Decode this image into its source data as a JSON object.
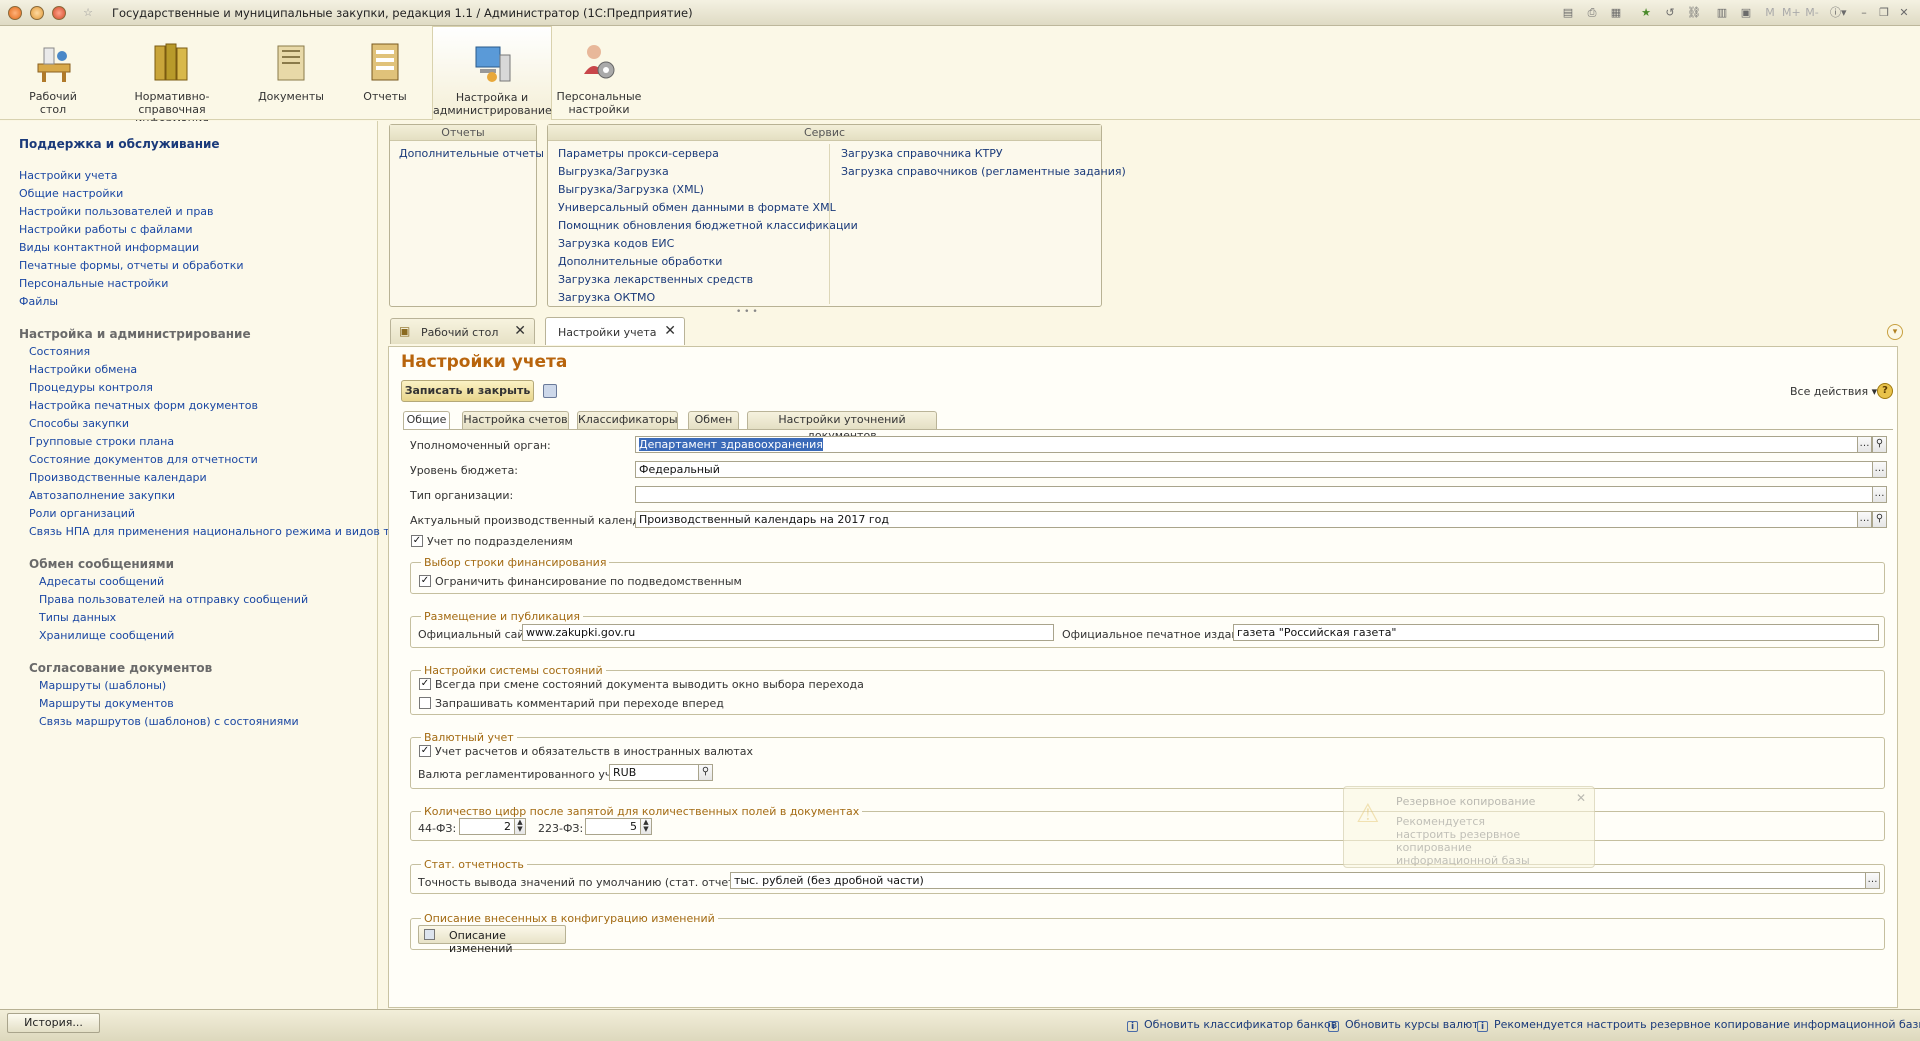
{
  "window": {
    "title": "Государственные и муниципальные закупки, редакция 1.1 / Администратор  (1С:Предприятие)",
    "right_icons": [
      "M",
      "M+",
      "M-"
    ]
  },
  "sections": [
    {
      "label": "Рабочий стол",
      "icon": "desk-icon"
    },
    {
      "label": "Нормативно-справочная информация",
      "icon": "books-icon"
    },
    {
      "label": "Документы",
      "icon": "documents-icon"
    },
    {
      "label": "Отчеты",
      "icon": "reports-icon"
    },
    {
      "label": "Настройка и администрирование",
      "icon": "computer-settings-icon"
    },
    {
      "label": "Персональные настройки",
      "icon": "person-settings-icon"
    }
  ],
  "nav": {
    "support_title": "Поддержка и обслуживание",
    "support_items": [
      "Настройки учета",
      "Общие настройки",
      "Настройки пользователей и прав",
      "Настройки работы с файлами",
      "Виды контактной информации",
      "Печатные формы, отчеты и обработки",
      "Персональные настройки",
      "Файлы"
    ],
    "admin_title": "Настройка и администрирование",
    "admin_items": [
      "Состояния",
      "Настройки обмена",
      "Процедуры контроля",
      "Настройка печатных форм документов",
      "Способы закупки",
      "Групповые строки плана",
      "Состояние документов для отчетности",
      "Производственные календари",
      "Автозаполнение закупки",
      "Роли организаций",
      "Связь НПА для применения национального режима и видов тр..."
    ],
    "messages_title": "Обмен сообщениями",
    "messages_items": [
      "Адресаты сообщений",
      "Права пользователей на отправку сообщений",
      "Типы данных",
      "Хранилище сообщений"
    ],
    "approval_title": "Согласование документов",
    "approval_items": [
      "Маршруты (шаблоны)",
      "Маршруты документов",
      "Связь маршрутов (шаблонов) с состояниями"
    ]
  },
  "reports_panel": {
    "title": "Отчеты",
    "items": [
      "Дополнительные отчеты"
    ]
  },
  "service_panel": {
    "title": "Сервис",
    "col1": [
      "Параметры прокси-сервера",
      "Выгрузка/Загрузка",
      "Выгрузка/Загрузка (XML)",
      "Универсальный обмен данными в формате XML",
      "Помощник обновления бюджетной классификации",
      "Загрузка кодов ЕИС",
      "Дополнительные обработки",
      "Загрузка лекарственных средств",
      "Загрузка ОКТМО"
    ],
    "col2": [
      "Загрузка справочника КТРУ",
      "Загрузка справочников (регламентные задания)"
    ]
  },
  "open_tabs": [
    {
      "label": "Рабочий стол"
    },
    {
      "label": "Настройки учета"
    }
  ],
  "form": {
    "title": "Настройки учета",
    "save_close": "Записать и закрыть",
    "all_actions": "Все действия",
    "tabs": [
      "Общие",
      "Настройка счетов",
      "Классификаторы",
      "Обмен",
      "Настройки уточнений документов"
    ],
    "authorized_label": "Уполномоченный орган:",
    "authorized_value": "Департамент здравоохранения",
    "budget_label": "Уровень бюджета:",
    "budget_value": "Федеральный",
    "orgtype_label": "Тип организации:",
    "orgtype_value": "",
    "calendar_label": "Актуальный производственный календарь:",
    "calendar_value": "Производственный календарь на 2017 год",
    "by_subdivisions": "Учет по подразделениям",
    "fin_group": "Выбор строки финансирования",
    "fin_limit": "Ограничить финансирование по подведомственным",
    "pub_group": "Размещение и публикация",
    "site_label": "Официальный сайт:",
    "site_value": "www.zakupki.gov.ru",
    "print_label": "Официальное печатное издание:",
    "print_value": "газета \"Российская газета\"",
    "state_group": "Настройки системы состояний",
    "state_opt1": "Всегда при смене состояний документа выводить окно выбора перехода",
    "state_opt2": "Запрашивать комментарий при переходе вперед",
    "currency_group": "Валютный учет",
    "currency_opt": "Учет расчетов и обязательств в иностранных валютах",
    "currency_label": "Валюта регламентированного учета:",
    "currency_value": "RUB",
    "digits_group": "Количество цифр после запятой для количественных полей в документах",
    "fz44_label": "44-ФЗ:",
    "fz44_value": "2",
    "fz223_label": "223-ФЗ:",
    "fz223_value": "5",
    "stat_group": "Стат. отчетность",
    "stat_label": "Точность вывода значений по умолчанию (стат. отчетность):",
    "stat_value": "тыс. рублей (без дробной части)",
    "desc_group": "Описание внесенных в конфигурацию изменений",
    "desc_button": "Описание изменений"
  },
  "notification": {
    "title": "Резервное копирование",
    "text": "Рекомендуется настроить резервное копирование информационной базы"
  },
  "statusbar": {
    "history": "История...",
    "links": [
      "Обновить классификатор банков",
      "Обновить курсы валют",
      "Рекомендуется настроить резервное копирование информационной базы."
    ]
  },
  "colors": {
    "accent": "#b8640c",
    "link": "#1a47a3",
    "background": "#fbf7e4"
  }
}
